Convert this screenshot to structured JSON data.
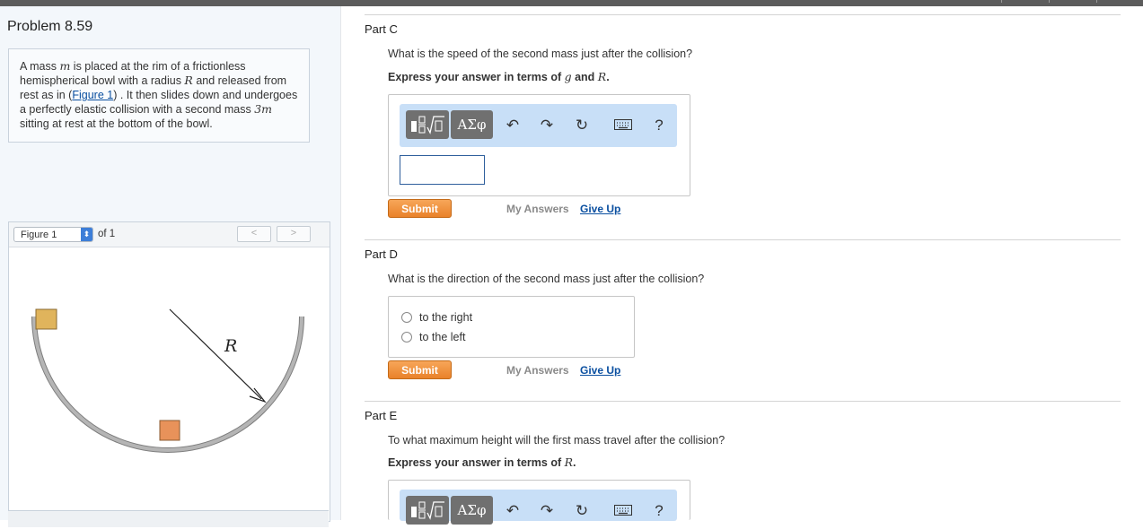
{
  "problem": {
    "title": "Problem 8.59"
  },
  "intro": {
    "t1": "A mass ",
    "var_m": "m",
    "t2": " is placed at the rim of a frictionless hemispherical bowl with a radius ",
    "var_R": "R",
    "t3": " and released from rest as in (",
    "fig_link": "Figure 1",
    "t4": ") . It then slides down and undergoes a perfectly elastic collision with a second mass ",
    "var_3m": "3m",
    "t5": " sitting at rest at the bottom of the bowl."
  },
  "figure": {
    "selected": "Figure 1",
    "of_text": "of 1",
    "prev": "<",
    "next": ">",
    "radius_label": "R",
    "colors": {
      "mass1": "#e0b45c",
      "mass2": "#e8925a",
      "bowl": "#b5b5b5"
    }
  },
  "toolbar": {
    "math_icon": "fraction-sqrt-icon",
    "symbols_label": "ΑΣφ",
    "undo_icon": "undo-icon",
    "redo_icon": "redo-icon",
    "reset_icon": "reset-icon",
    "keyboard_icon": "keyboard-icon",
    "help_label": "?"
  },
  "parts": {
    "c": {
      "label": "Part C",
      "question": "What is the speed of the second mass just after the collision?",
      "express_prefix": "Express your answer in terms of ",
      "var1": "g",
      "and": " and ",
      "var2": "R",
      "dot": ".",
      "input_value": ""
    },
    "d": {
      "label": "Part D",
      "question": "What is the direction of the second mass just after the collision?",
      "options": [
        "to the right",
        "to the left"
      ]
    },
    "e": {
      "label": "Part E",
      "question": "To what maximum height will the first mass travel after the collision?",
      "express_prefix": "Express your answer in terms of ",
      "var1": "R",
      "dot": "."
    }
  },
  "actions": {
    "submit": "Submit",
    "my_answers": "My Answers",
    "give_up": "Give Up"
  },
  "colors": {
    "accent": "#e9822a",
    "link": "#0a4fa0",
    "toolbar_bg": "#c8dff7"
  }
}
